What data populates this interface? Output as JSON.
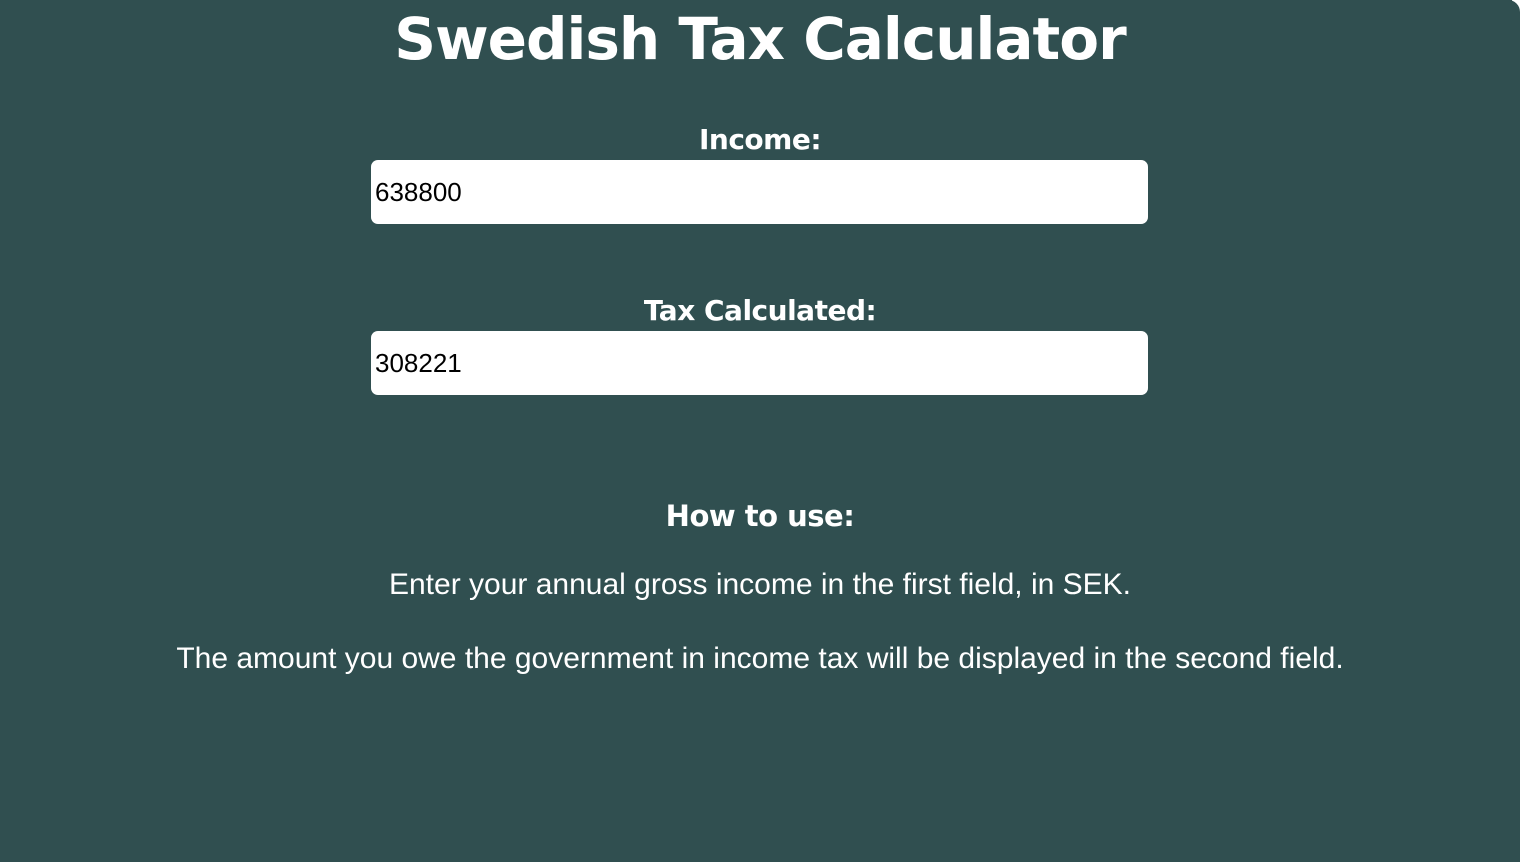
{
  "page": {
    "title": "Swedish Tax Calculator",
    "background_color": "#304f50",
    "text_color": "#ffffff"
  },
  "form": {
    "income_label": "Income:",
    "income_value": "638800",
    "tax_label": "Tax Calculated:",
    "tax_value": "308221"
  },
  "instructions": {
    "heading": "How to use:",
    "step1": "Enter your annual gross income in the first field, in SEK.",
    "step2": "The amount you owe the government in income tax will be displayed in the second field."
  }
}
